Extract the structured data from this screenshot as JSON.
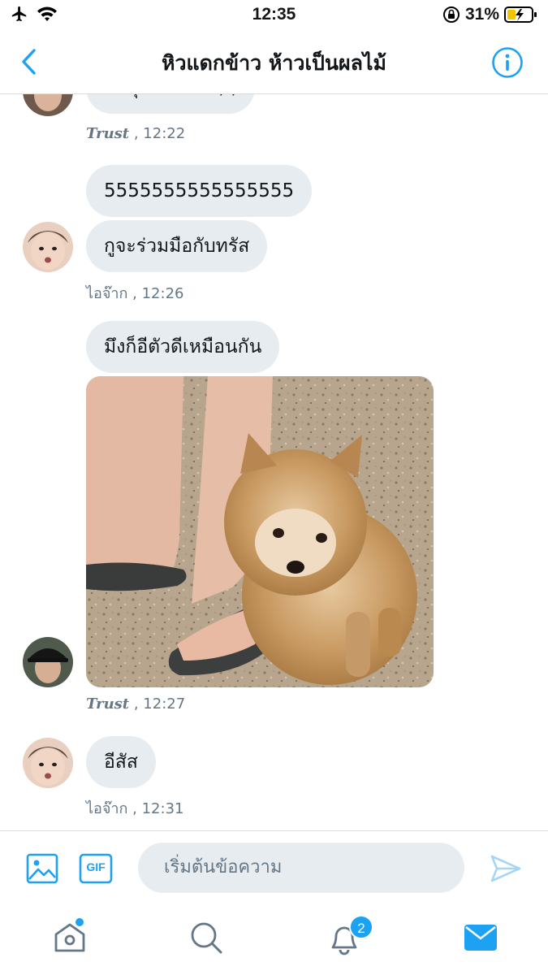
{
  "status_bar": {
    "time": "12:35",
    "battery": "31%"
  },
  "header": {
    "title": "หิวแดกข้าว ห้าวเป็นผลไม้"
  },
  "messages": [
    {
      "text": "กับลุงหัวบิดติ้ม; ;",
      "sender": "Trust",
      "time": ", 12:22"
    },
    {
      "text": "5555555555555555"
    },
    {
      "text": "กูจะร่วมมือกับทรัส",
      "sender": "ไอจ๊าก",
      "time": ", 12:26"
    },
    {
      "text": "มึงก็อีตัวดีเหมือนกัน",
      "sender": "Trust",
      "time": ", 12:27",
      "photo": "pomeranian-puppy-photo"
    },
    {
      "text": "อีสัส",
      "sender": "ไอจ๊าก",
      "time": ", 12:31"
    }
  ],
  "composer": {
    "placeholder": "เริ่มต้นข้อความ",
    "gif_label": "GIF"
  },
  "tabbar": {
    "notification_count": "2"
  },
  "colors": {
    "accent": "#1da1f2",
    "bubble": "#e6ecf0",
    "meta": "#657786"
  }
}
